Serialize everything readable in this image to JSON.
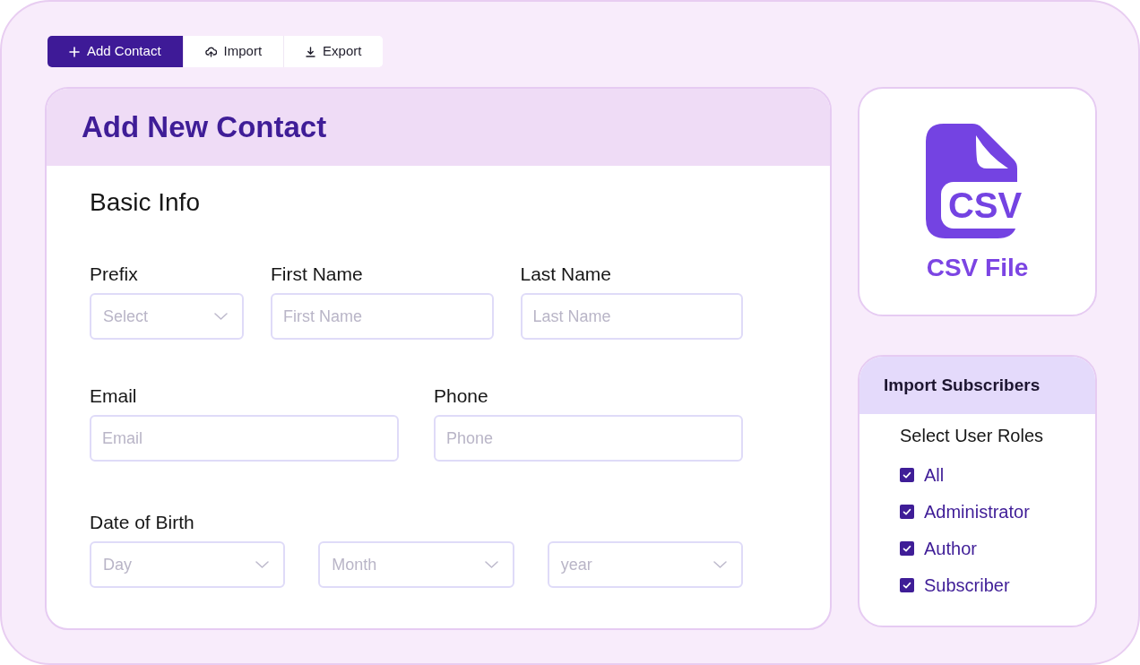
{
  "toolbar": [
    {
      "label": "Add Contact",
      "kind": "add",
      "selected": true
    },
    {
      "label": "Import",
      "kind": "import",
      "selected": false
    },
    {
      "label": "Export",
      "kind": "export",
      "selected": false
    }
  ],
  "contact_form": {
    "title": "Add New Contact",
    "section_title": "Basic Info",
    "rows": [
      {
        "fields": [
          {
            "label": "Prefix",
            "kind": "select",
            "placeholder": "Select"
          },
          {
            "label": "First Name",
            "kind": "text",
            "placeholder": "First Name"
          },
          {
            "label": "Last Name",
            "kind": "text",
            "placeholder": "Last Name"
          }
        ]
      },
      {
        "fields": [
          {
            "label": "Email",
            "kind": "text",
            "placeholder": "Email"
          },
          {
            "label": "Phone",
            "kind": "text",
            "placeholder": "Phone"
          }
        ]
      },
      {
        "label": "Date of Birth",
        "fields": [
          {
            "kind": "select",
            "placeholder": "Day"
          },
          {
            "kind": "select",
            "placeholder": "Month"
          },
          {
            "kind": "select",
            "placeholder": "year"
          }
        ]
      }
    ]
  },
  "csv_card": {
    "icon_text": "CSV",
    "label": "CSV File"
  },
  "import_subscribers": {
    "title": "Import Subscribers",
    "subtitle": "Select User Roles",
    "roles": [
      {
        "label": "All",
        "checked": true
      },
      {
        "label": "Administrator",
        "checked": true
      },
      {
        "label": "Author",
        "checked": true
      },
      {
        "label": "Subscriber",
        "checked": true
      }
    ]
  }
}
